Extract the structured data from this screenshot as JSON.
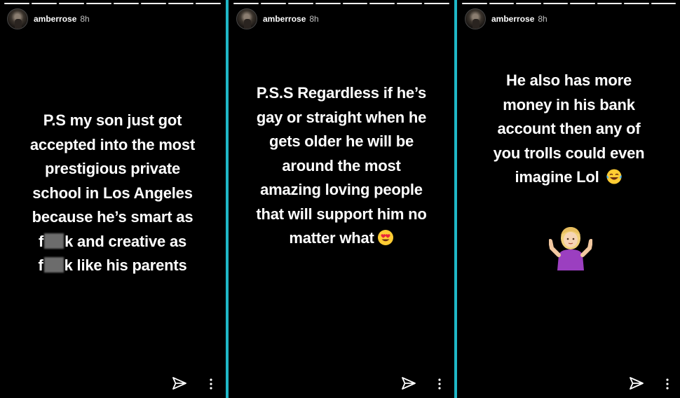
{
  "colors": {
    "background": "#000000",
    "divider": "#1fb7c7",
    "text": "#ffffff"
  },
  "stories": [
    {
      "username": "amberrose",
      "time": "8h",
      "lines": [
        "P.S my son just got",
        "accepted into the most",
        "prestigious private",
        "school in Los Angeles",
        "because he’s smart as",
        "k and creative as",
        "k  like his parents"
      ],
      "censor_prefix": "f"
    },
    {
      "username": "amberrose",
      "time": "8h",
      "lines": [
        "P.S.S Regardless if he’s",
        "gay or straight when he",
        "gets older he will be",
        "around the most",
        "amazing loving people",
        "that will support him no",
        "matter what"
      ],
      "emoji": "heart-eyes-emoji"
    },
    {
      "username": "amberrose",
      "time": "8h",
      "lines": [
        "He also has more",
        "money in his bank",
        "account then any of",
        "you trolls could even",
        "imagine Lol"
      ],
      "emoji": "tears-of-joy-emoji",
      "sticker": "shrugging-woman-emoji"
    }
  ],
  "icons": {
    "send": "paper-plane-icon",
    "more": "vertical-ellipsis-icon"
  }
}
